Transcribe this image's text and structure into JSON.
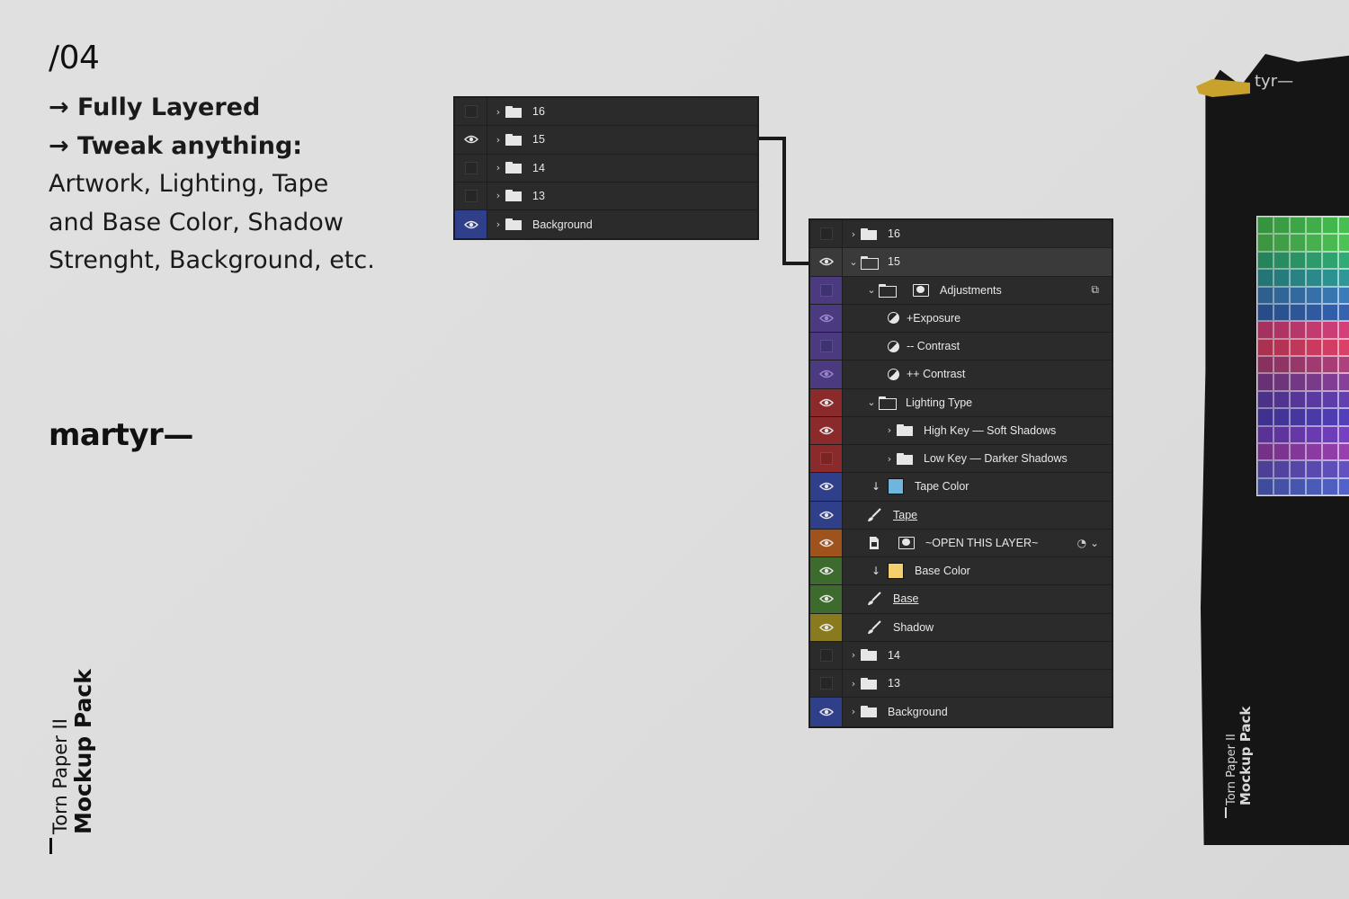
{
  "intro": {
    "number": "/04",
    "lines": [
      "→ Fully Layered",
      "→ Tweak anything:",
      "Artwork, Lighting, Tape",
      "and Base Color, Shadow",
      "Strenght, Background, etc."
    ]
  },
  "brand": "martyr—",
  "product": {
    "line1": "Torn Paper II",
    "line2": "Mockup Pack"
  },
  "poster": {
    "brand": "tyr—"
  },
  "colors": {
    "purple": "#4b3a7f",
    "red": "#8b2a2a",
    "blue": "#2f3f8a",
    "orange": "#a0521d",
    "green": "#3d6b2e",
    "olive": "#8a7a1e",
    "tape_swatch": "#6eb6dc",
    "base_swatch": "#f3d06b"
  },
  "panel_small": {
    "rows": [
      {
        "label": "16",
        "visible": false
      },
      {
        "label": "15",
        "visible": true
      },
      {
        "label": "14",
        "visible": false
      },
      {
        "label": "13",
        "visible": false
      },
      {
        "label": "Background",
        "visible": true
      }
    ]
  },
  "panel_large": {
    "rows": [
      {
        "label": "16"
      },
      {
        "label": "15"
      },
      {
        "label": "Adjustments"
      },
      {
        "label": "+Exposure"
      },
      {
        "label": "-- Contrast"
      },
      {
        "label": "++ Contrast"
      },
      {
        "label": "Lighting Type"
      },
      {
        "label": "High Key — Soft Shadows"
      },
      {
        "label": "Low Key — Darker Shadows"
      },
      {
        "label": "Tape Color"
      },
      {
        "label": "Tape"
      },
      {
        "label": "~OPEN THIS LAYER~"
      },
      {
        "label": "Base Color"
      },
      {
        "label": "Base"
      },
      {
        "label": "Shadow"
      },
      {
        "label": "14"
      },
      {
        "label": "13"
      },
      {
        "label": "Background"
      }
    ]
  }
}
